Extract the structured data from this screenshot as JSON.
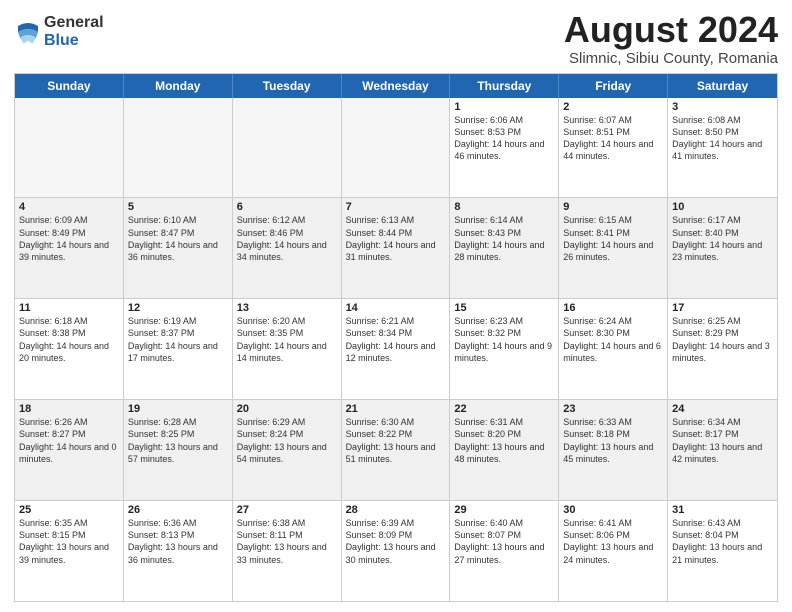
{
  "logo": {
    "general": "General",
    "blue": "Blue"
  },
  "title": "August 2024",
  "subtitle": "Slimnic, Sibiu County, Romania",
  "header_days": [
    "Sunday",
    "Monday",
    "Tuesday",
    "Wednesday",
    "Thursday",
    "Friday",
    "Saturday"
  ],
  "weeks": [
    [
      {
        "day": "",
        "info": "",
        "empty": true
      },
      {
        "day": "",
        "info": "",
        "empty": true
      },
      {
        "day": "",
        "info": "",
        "empty": true
      },
      {
        "day": "",
        "info": "",
        "empty": true
      },
      {
        "day": "1",
        "info": "Sunrise: 6:06 AM\nSunset: 8:53 PM\nDaylight: 14 hours\nand 46 minutes."
      },
      {
        "day": "2",
        "info": "Sunrise: 6:07 AM\nSunset: 8:51 PM\nDaylight: 14 hours\nand 44 minutes."
      },
      {
        "day": "3",
        "info": "Sunrise: 6:08 AM\nSunset: 8:50 PM\nDaylight: 14 hours\nand 41 minutes."
      }
    ],
    [
      {
        "day": "4",
        "info": "Sunrise: 6:09 AM\nSunset: 8:49 PM\nDaylight: 14 hours\nand 39 minutes.",
        "shaded": true
      },
      {
        "day": "5",
        "info": "Sunrise: 6:10 AM\nSunset: 8:47 PM\nDaylight: 14 hours\nand 36 minutes.",
        "shaded": true
      },
      {
        "day": "6",
        "info": "Sunrise: 6:12 AM\nSunset: 8:46 PM\nDaylight: 14 hours\nand 34 minutes.",
        "shaded": true
      },
      {
        "day": "7",
        "info": "Sunrise: 6:13 AM\nSunset: 8:44 PM\nDaylight: 14 hours\nand 31 minutes.",
        "shaded": true
      },
      {
        "day": "8",
        "info": "Sunrise: 6:14 AM\nSunset: 8:43 PM\nDaylight: 14 hours\nand 28 minutes.",
        "shaded": true
      },
      {
        "day": "9",
        "info": "Sunrise: 6:15 AM\nSunset: 8:41 PM\nDaylight: 14 hours\nand 26 minutes.",
        "shaded": true
      },
      {
        "day": "10",
        "info": "Sunrise: 6:17 AM\nSunset: 8:40 PM\nDaylight: 14 hours\nand 23 minutes.",
        "shaded": true
      }
    ],
    [
      {
        "day": "11",
        "info": "Sunrise: 6:18 AM\nSunset: 8:38 PM\nDaylight: 14 hours\nand 20 minutes."
      },
      {
        "day": "12",
        "info": "Sunrise: 6:19 AM\nSunset: 8:37 PM\nDaylight: 14 hours\nand 17 minutes."
      },
      {
        "day": "13",
        "info": "Sunrise: 6:20 AM\nSunset: 8:35 PM\nDaylight: 14 hours\nand 14 minutes."
      },
      {
        "day": "14",
        "info": "Sunrise: 6:21 AM\nSunset: 8:34 PM\nDaylight: 14 hours\nand 12 minutes."
      },
      {
        "day": "15",
        "info": "Sunrise: 6:23 AM\nSunset: 8:32 PM\nDaylight: 14 hours\nand 9 minutes."
      },
      {
        "day": "16",
        "info": "Sunrise: 6:24 AM\nSunset: 8:30 PM\nDaylight: 14 hours\nand 6 minutes."
      },
      {
        "day": "17",
        "info": "Sunrise: 6:25 AM\nSunset: 8:29 PM\nDaylight: 14 hours\nand 3 minutes."
      }
    ],
    [
      {
        "day": "18",
        "info": "Sunrise: 6:26 AM\nSunset: 8:27 PM\nDaylight: 14 hours\nand 0 minutes.",
        "shaded": true
      },
      {
        "day": "19",
        "info": "Sunrise: 6:28 AM\nSunset: 8:25 PM\nDaylight: 13 hours\nand 57 minutes.",
        "shaded": true
      },
      {
        "day": "20",
        "info": "Sunrise: 6:29 AM\nSunset: 8:24 PM\nDaylight: 13 hours\nand 54 minutes.",
        "shaded": true
      },
      {
        "day": "21",
        "info": "Sunrise: 6:30 AM\nSunset: 8:22 PM\nDaylight: 13 hours\nand 51 minutes.",
        "shaded": true
      },
      {
        "day": "22",
        "info": "Sunrise: 6:31 AM\nSunset: 8:20 PM\nDaylight: 13 hours\nand 48 minutes.",
        "shaded": true
      },
      {
        "day": "23",
        "info": "Sunrise: 6:33 AM\nSunset: 8:18 PM\nDaylight: 13 hours\nand 45 minutes.",
        "shaded": true
      },
      {
        "day": "24",
        "info": "Sunrise: 6:34 AM\nSunset: 8:17 PM\nDaylight: 13 hours\nand 42 minutes.",
        "shaded": true
      }
    ],
    [
      {
        "day": "25",
        "info": "Sunrise: 6:35 AM\nSunset: 8:15 PM\nDaylight: 13 hours\nand 39 minutes."
      },
      {
        "day": "26",
        "info": "Sunrise: 6:36 AM\nSunset: 8:13 PM\nDaylight: 13 hours\nand 36 minutes."
      },
      {
        "day": "27",
        "info": "Sunrise: 6:38 AM\nSunset: 8:11 PM\nDaylight: 13 hours\nand 33 minutes."
      },
      {
        "day": "28",
        "info": "Sunrise: 6:39 AM\nSunset: 8:09 PM\nDaylight: 13 hours\nand 30 minutes."
      },
      {
        "day": "29",
        "info": "Sunrise: 6:40 AM\nSunset: 8:07 PM\nDaylight: 13 hours\nand 27 minutes."
      },
      {
        "day": "30",
        "info": "Sunrise: 6:41 AM\nSunset: 8:06 PM\nDaylight: 13 hours\nand 24 minutes."
      },
      {
        "day": "31",
        "info": "Sunrise: 6:43 AM\nSunset: 8:04 PM\nDaylight: 13 hours\nand 21 minutes."
      }
    ]
  ]
}
